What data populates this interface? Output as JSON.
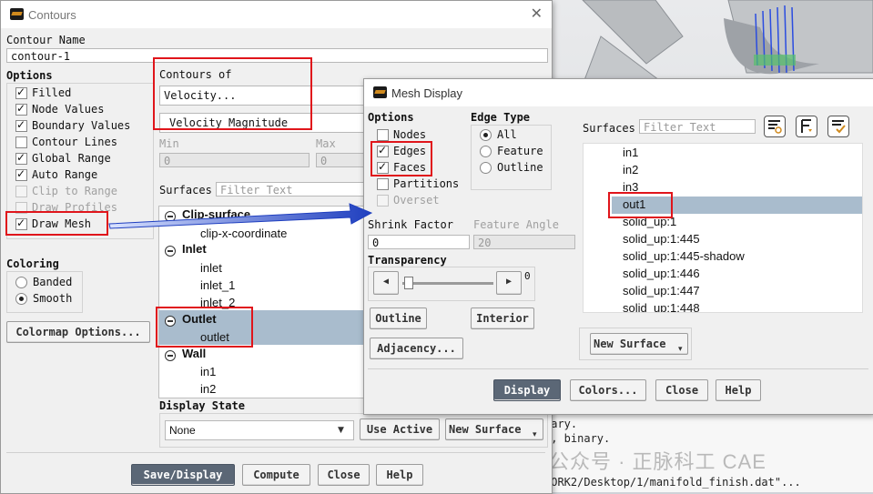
{
  "contours": {
    "title": "Contours",
    "contour_name_label": "Contour Name",
    "contour_name_value": "contour-1",
    "options_label": "Options",
    "options": [
      {
        "label": "Filled",
        "checked": true,
        "enabled": true
      },
      {
        "label": "Node Values",
        "checked": true,
        "enabled": true
      },
      {
        "label": "Boundary Values",
        "checked": true,
        "enabled": true
      },
      {
        "label": "Contour Lines",
        "checked": false,
        "enabled": true
      },
      {
        "label": "Global Range",
        "checked": true,
        "enabled": true
      },
      {
        "label": "Auto Range",
        "checked": true,
        "enabled": true
      },
      {
        "label": "Clip to Range",
        "checked": false,
        "enabled": false
      },
      {
        "label": "Draw Profiles",
        "checked": false,
        "enabled": false
      },
      {
        "label": "Draw Mesh",
        "checked": true,
        "enabled": true
      }
    ],
    "coloring_label": "Coloring",
    "coloring_options": [
      "Banded",
      "Smooth"
    ],
    "coloring_selected": "Smooth",
    "colormap_button": "Colormap Options...",
    "contours_of_label": "Contours of",
    "contours_of_value": "Velocity...",
    "contours_of_sub": "Velocity Magnitude",
    "min_label": "Min",
    "min_value": "0",
    "max_label": "Max",
    "max_value": "0",
    "surfaces_label": "Surfaces",
    "filter_placeholder": "Filter Text",
    "tree": [
      {
        "group": "Clip-surface",
        "items": [
          "clip-x-coordinate"
        ]
      },
      {
        "group": "Inlet",
        "items": [
          "inlet",
          "inlet_1",
          "inlet_2"
        ]
      },
      {
        "group": "Outlet",
        "items": [
          "outlet"
        ]
      },
      {
        "group": "Wall",
        "items": [
          "in1",
          "in2"
        ]
      }
    ],
    "display_state_label": "Display State",
    "display_state_value": "None",
    "use_active_button": "Use Active",
    "new_surface_button": "New Surface",
    "footer_buttons": [
      "Save/Display",
      "Compute",
      "Close",
      "Help"
    ]
  },
  "mesh": {
    "title": "Mesh Display",
    "options_label": "Options",
    "options": [
      {
        "label": "Nodes",
        "checked": false,
        "enabled": true
      },
      {
        "label": "Edges",
        "checked": true,
        "enabled": true
      },
      {
        "label": "Faces",
        "checked": true,
        "enabled": true
      },
      {
        "label": "Partitions",
        "checked": false,
        "enabled": true
      },
      {
        "label": "Overset",
        "checked": false,
        "enabled": false
      }
    ],
    "edge_type_label": "Edge Type",
    "edge_types": [
      "All",
      "Feature",
      "Outline"
    ],
    "edge_type_selected": "All",
    "shrink_factor_label": "Shrink Factor",
    "shrink_factor_value": "0",
    "feature_angle_label": "Feature Angle",
    "feature_angle_value": "20",
    "transparency_label": "Transparency",
    "transparency_value": "0",
    "outline_button": "Outline",
    "interior_button": "Interior",
    "adjacency_button": "Adjacency...",
    "surfaces_label": "Surfaces",
    "filter_placeholder": "Filter Text",
    "surfaces": [
      "in1",
      "in2",
      "in3",
      "out1",
      "solid_up:1",
      "solid_up:1:445",
      "solid_up:1:445-shadow",
      "solid_up:1:446",
      "solid_up:1:447",
      "solid_up:1:448"
    ],
    "selected_surface": "out1",
    "new_surface_button": "New Surface",
    "footer_buttons": [
      "Display",
      "Colors...",
      "Close",
      "Help"
    ]
  },
  "console_lines": [
    "nary.",
    "s, binary.",
    "WORK2/Desktop/1/manifold_finish.dat\"..."
  ],
  "watermark": "公众号 · 正脉科工 CAE",
  "colors": {
    "highlight": "#a9bccd",
    "primary_button": "#5b6776",
    "annotation_red": "#e0151b",
    "arrow_blue": "#1f3fbf"
  }
}
